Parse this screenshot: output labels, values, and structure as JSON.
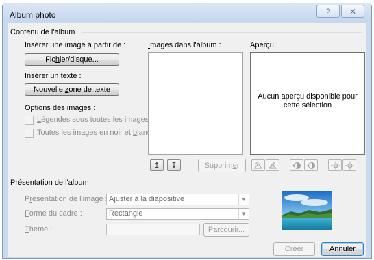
{
  "window": {
    "title": "Album photo",
    "help_glyph": "?",
    "close_glyph": "✕"
  },
  "album_content": {
    "section_label": "Contenu de l'album",
    "insert_image_label": "Insérer une image à partir de :",
    "file_button": {
      "pre": "Fic",
      "accel": "h",
      "post": "ier/disque..."
    },
    "insert_text_label": "Insérer un texte :",
    "new_textbox_button": {
      "pre": "Nouvelle ",
      "accel": "z",
      "post": "one de texte"
    },
    "image_options_label": "Options des images :",
    "captions_checkbox": {
      "pre": "",
      "accel": "L",
      "post": "égendes sous toutes les images",
      "checked": false
    },
    "bw_checkbox": {
      "pre": "Toutes les images en noir et ",
      "accel": "b",
      "post": "lanc",
      "checked": false
    },
    "images_in_album_label": {
      "pre": "",
      "accel": "I",
      "post": "mages dans l'album :"
    },
    "move_up_glyph": "↥",
    "move_down_glyph": "↧",
    "remove_button": {
      "pre": "Supprim",
      "accel": "e",
      "post": "r"
    },
    "preview_label": "Aperçu :",
    "preview_message": "Aucun aperçu disponible pour cette sélection",
    "tool_icons": [
      "rotate-left-icon",
      "rotate-right-icon",
      "contrast-up-icon",
      "contrast-down-icon",
      "brightness-up-icon",
      "brightness-down-icon"
    ]
  },
  "album_layout": {
    "section_label": "Présentation de l'album",
    "layout_label": {
      "pre": "P",
      "accel": "r",
      "post": "ésentation de l'image :"
    },
    "layout_value": "Ajuster à la diapositive",
    "frame_label": {
      "pre": "",
      "accel": "F",
      "post": "orme du cadre :"
    },
    "frame_value": "Rectangle",
    "theme_label": {
      "pre": "",
      "accel": "T",
      "post": "hème :"
    },
    "theme_value": "",
    "browse_button": {
      "pre": "",
      "accel": "P",
      "post": "arcourir..."
    }
  },
  "footer": {
    "create_button": {
      "pre": "",
      "accel": "C",
      "post": "réer"
    },
    "cancel_button": "Annuler"
  },
  "colors": {
    "frame": "#c9d9ee",
    "client": "#f0f0f0",
    "sky_top": "#1b6fc7",
    "sea": "#1f8fb8"
  }
}
